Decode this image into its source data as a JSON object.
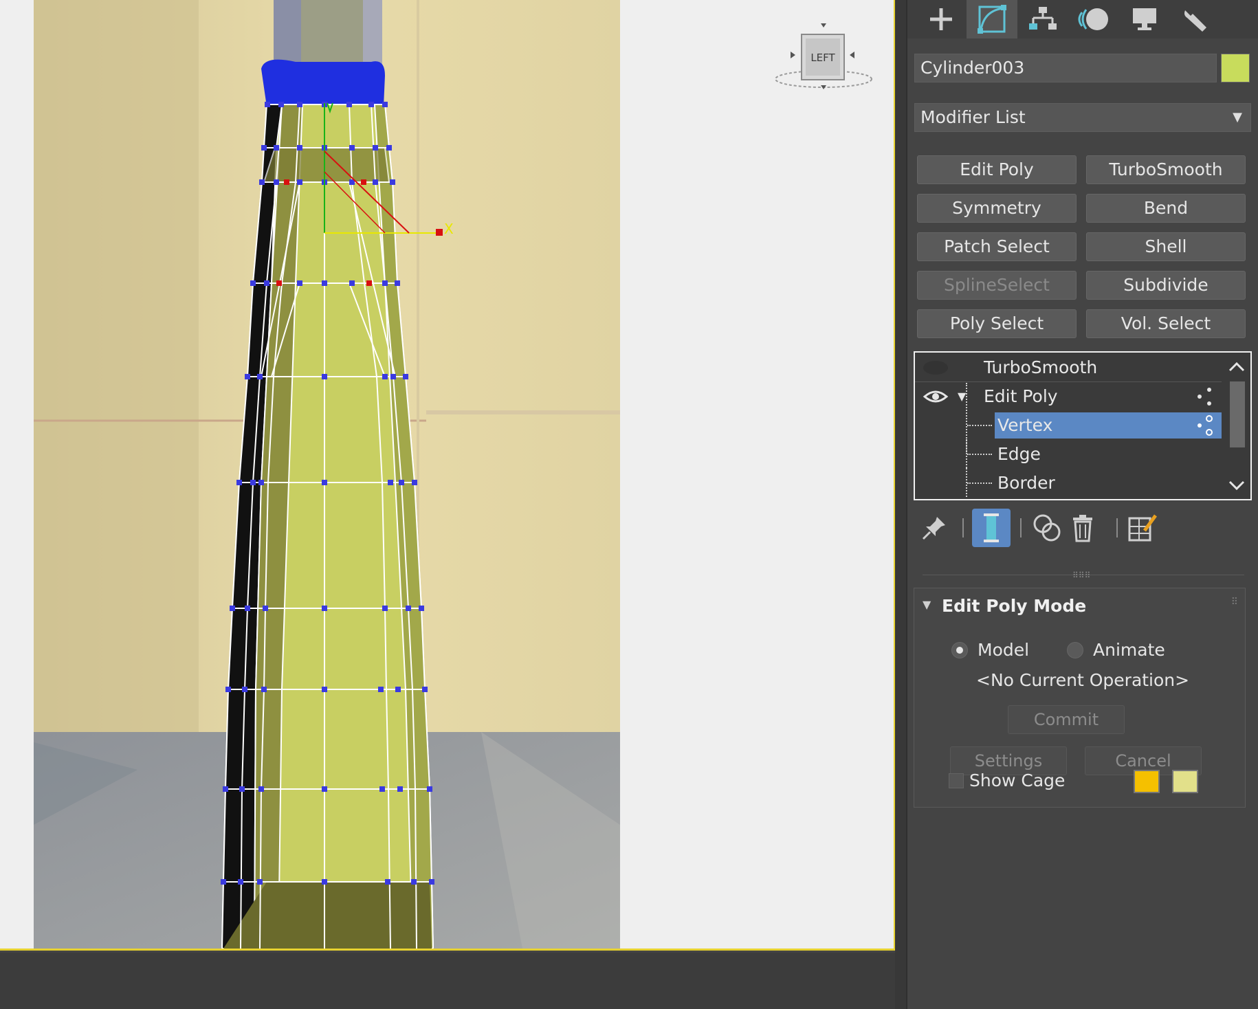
{
  "viewport": {
    "label": "viewport-left",
    "viewcube_label": "LEFT",
    "gizmo_axis_label": "X",
    "colors": {
      "background": "#efefef",
      "border": "#e7d230",
      "mesh_fill": "#c8cf62",
      "mesh_dark": "#6a6a2c",
      "vertex": "#3a3ae0",
      "selected_vertex": "#d81010",
      "cap": "#1f2fe0"
    }
  },
  "command_panel": {
    "tabs": [
      {
        "name": "create",
        "icon": "plus-icon"
      },
      {
        "name": "modify",
        "icon": "modify-curve-icon",
        "active": true
      },
      {
        "name": "hierarchy",
        "icon": "hierarchy-icon"
      },
      {
        "name": "motion",
        "icon": "motion-icon"
      },
      {
        "name": "display",
        "icon": "display-monitor-icon"
      },
      {
        "name": "utilities",
        "icon": "wrench-icon"
      }
    ],
    "object_name": "Cylinder003",
    "object_color": "#c8dc5c",
    "modifier_list_label": "Modifier List",
    "modifier_buttons": [
      {
        "label": "Edit Poly",
        "enabled": true
      },
      {
        "label": "TurboSmooth",
        "enabled": true
      },
      {
        "label": "Symmetry",
        "enabled": true
      },
      {
        "label": "Bend",
        "enabled": true
      },
      {
        "label": "Patch Select",
        "enabled": true
      },
      {
        "label": "Shell",
        "enabled": true
      },
      {
        "label": "SplineSelect",
        "enabled": false
      },
      {
        "label": "Subdivide",
        "enabled": true
      },
      {
        "label": "Poly Select",
        "enabled": true
      },
      {
        "label": "Vol. Select",
        "enabled": true
      }
    ],
    "stack": [
      {
        "label": "TurboSmooth",
        "level": 0,
        "visible": false
      },
      {
        "label": "Edit Poly",
        "level": 0,
        "visible": true,
        "expanded": true
      },
      {
        "label": "Vertex",
        "level": 1,
        "selected": true
      },
      {
        "label": "Edge",
        "level": 1
      },
      {
        "label": "Border",
        "level": 1
      }
    ],
    "stack_tools": [
      "pin-stack-icon",
      "show-end-result-icon",
      "make-unique-icon",
      "remove-modifier-icon",
      "configure-modifier-sets-icon"
    ],
    "rollout": {
      "title": "Edit Poly Mode",
      "mode_model": "Model",
      "mode_animate": "Animate",
      "selected_mode": "Model",
      "current_operation": "<No Current Operation>",
      "commit_label": "Commit",
      "settings_label": "Settings",
      "cancel_label": "Cancel",
      "show_cage_label": "Show Cage",
      "show_cage_checked": false,
      "cage_color_1": "#f5c000",
      "cage_color_2": "#e2e08a"
    },
    "accent": "#5b88c4"
  }
}
